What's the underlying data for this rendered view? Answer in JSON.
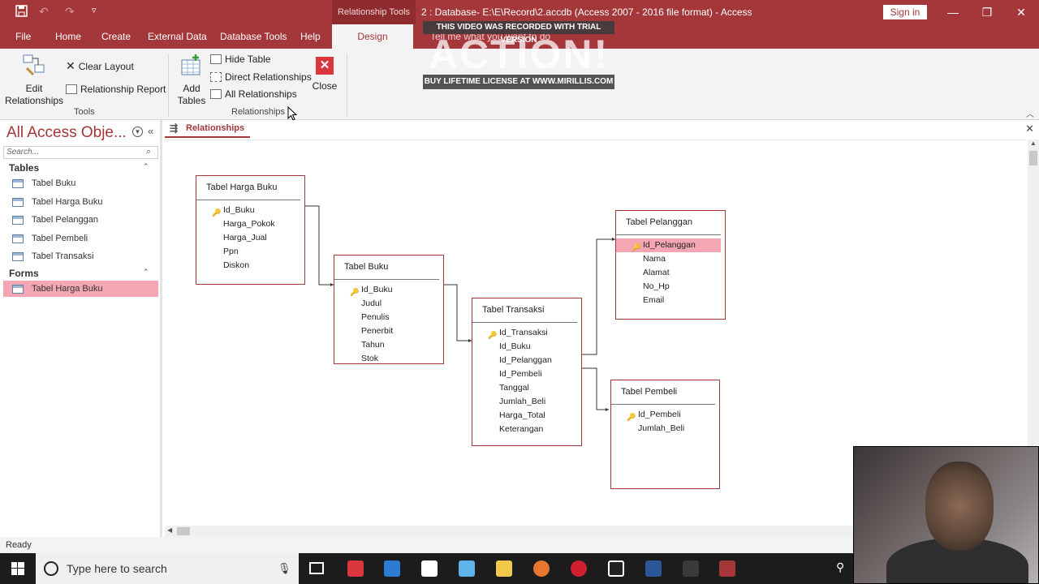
{
  "titlebar": {
    "context_tab": "Relationship Tools",
    "doc_title": "2 : Database- E:\\E\\Record\\2.accdb (Access 2007 - 2016 file format)  -  Access",
    "signin": "Sign in"
  },
  "tabs": [
    "File",
    "Home",
    "Create",
    "External Data",
    "Database Tools",
    "Help",
    "Design"
  ],
  "tell_me": "Tell me what you want to do",
  "ribbon": {
    "edit_relationships": "Edit Relationships",
    "clear_layout": "Clear Layout",
    "relationship_report": "Relationship Report",
    "tools_group": "Tools",
    "add_tables": "Add Tables",
    "hide_table": "Hide Table",
    "direct_relationships": "Direct Relationships",
    "all_relationships": "All Relationships",
    "relationships_group": "Relationships",
    "close": "Close"
  },
  "watermark": {
    "top": "THIS VIDEO WAS RECORDED WITH TRIAL VERSION",
    "big": "ACTION!",
    "bottom": "BUY LIFETIME LICENSE AT WWW.MIRILLIS.COM"
  },
  "nav": {
    "title": "All Access Obje...",
    "search_placeholder": "Search...",
    "tables_header": "Tables",
    "tables": [
      "Tabel Buku",
      "Tabel Harga Buku",
      "Tabel Pelanggan",
      "Tabel Pembeli",
      "Tabel Transaksi"
    ],
    "forms_header": "Forms",
    "forms": [
      "Tabel Harga Buku"
    ]
  },
  "document": {
    "tab_label": "Relationships",
    "tables": [
      {
        "title": "Tabel Harga Buku",
        "fields": [
          "Id_Buku",
          "Harga_Pokok",
          "Harga_Jual",
          "Ppn",
          "Diskon"
        ]
      },
      {
        "title": "Tabel Buku",
        "fields": [
          "Id_Buku",
          "Judul",
          "Penulis",
          "Penerbit",
          "Tahun",
          "Stok"
        ]
      },
      {
        "title": "Tabel Transaksi",
        "fields": [
          "Id_Transaksi",
          "Id_Buku",
          "Id_Pelanggan",
          "Id_Pembeli",
          "Tanggal",
          "Jumlah_Beli",
          "Harga_Total",
          "Keterangan"
        ]
      },
      {
        "title": "Tabel Pelanggan",
        "fields": [
          "Id_Pelanggan",
          "Nama",
          "Alamat",
          "No_Hp",
          "Email"
        ]
      },
      {
        "title": "Tabel Pembeli",
        "fields": [
          "Id_Pembeli",
          "Jumlah_Beli"
        ]
      }
    ]
  },
  "status": "Ready",
  "taskbar": {
    "search_placeholder": "Type here to search"
  },
  "colors": {
    "accent": "#a4373a",
    "selected": "#f4a7b3"
  }
}
